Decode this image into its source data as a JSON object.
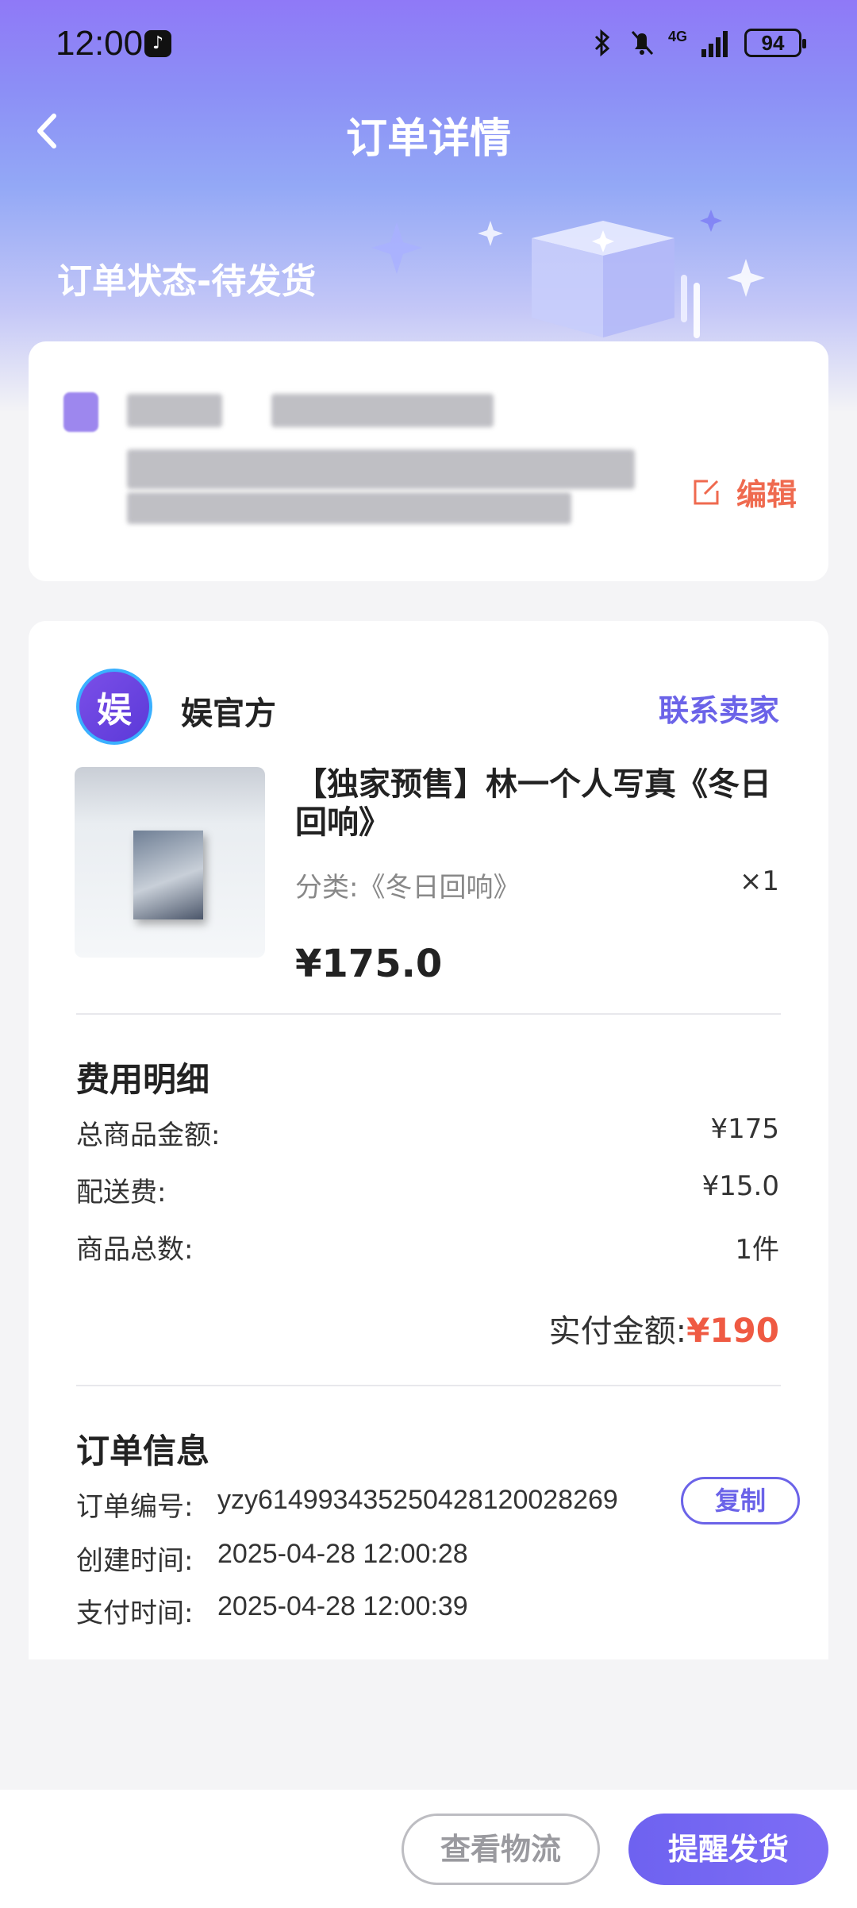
{
  "status_bar": {
    "time": "12:00",
    "battery": "94",
    "network": "4G"
  },
  "nav": {
    "title": "订单详情"
  },
  "order_status": "订单状态-待发货",
  "address": {
    "edit_label": "编辑"
  },
  "shop": {
    "name": "娱官方",
    "logo_text": "娱",
    "contact_label": "联系卖家"
  },
  "product": {
    "title": "【独家预售】林一个人写真《冬日回响》",
    "variant": "分类:《冬日回响》",
    "quantity": "×1",
    "price": "¥175.0"
  },
  "fees": {
    "section_title": "费用明细",
    "rows": [
      {
        "label": "总商品金额:",
        "value": "¥175"
      },
      {
        "label": "配送费:",
        "value": "¥15.0"
      },
      {
        "label": "商品总数:",
        "value": "1件"
      }
    ],
    "paid_label": "实付金额:",
    "paid_value": "¥190"
  },
  "order_info": {
    "section_title": "订单信息",
    "rows": [
      {
        "label": "订单编号:",
        "value": "yzy6149934352504281200 28269"
      },
      {
        "label": "创建时间:",
        "value": "2025-04-28 12:00:28"
      },
      {
        "label": "支付时间:",
        "value": "2025-04-28 12:00:39"
      }
    ],
    "copy_label": "复制"
  },
  "bottom": {
    "logistics_label": "查看物流",
    "remind_label": "提醒发货"
  },
  "colors": {
    "accent": "#6b63e8",
    "price_red": "#ef5a43",
    "edit_orange": "#ef6a4f"
  }
}
